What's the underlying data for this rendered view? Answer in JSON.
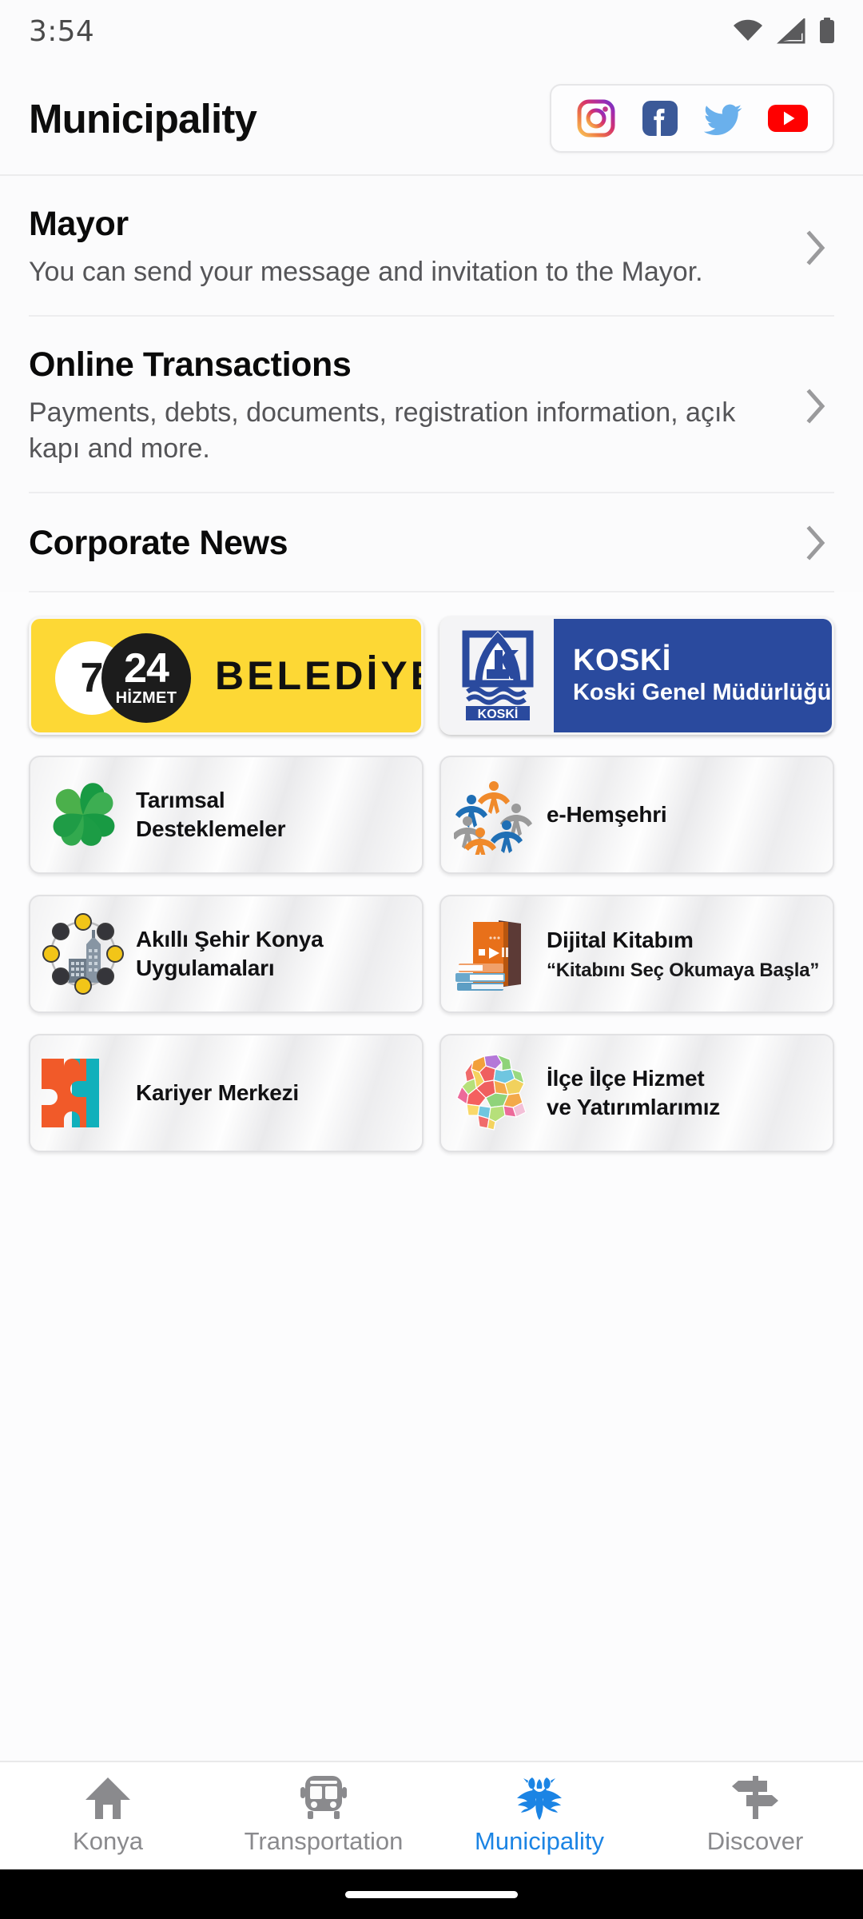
{
  "status_bar": {
    "time": "3:54",
    "icons": [
      "wifi-icon",
      "cellular-signal-icon",
      "battery-icon"
    ]
  },
  "header": {
    "title": "Municipality",
    "social_links": [
      {
        "name": "instagram",
        "label": "Instagram"
      },
      {
        "name": "facebook",
        "label": "Facebook"
      },
      {
        "name": "twitter",
        "label": "Twitter"
      },
      {
        "name": "youtube",
        "label": "YouTube"
      }
    ]
  },
  "menu": [
    {
      "title": "Mayor",
      "subtitle": "You can send your message and invitation to the Mayor."
    },
    {
      "title": "Online Transactions",
      "subtitle": "Payments, debts, documents, registration information, açık kapı and more."
    },
    {
      "title": "Corporate News",
      "subtitle": ""
    }
  ],
  "tiles": [
    {
      "id": "belediye-724",
      "seven": "7",
      "twentyfour": "24",
      "hizmet": "HİZMET",
      "word": "BELEDİYE",
      "background": "#fdd835"
    },
    {
      "id": "koski",
      "logo_text": "KOSKİ",
      "title": "KOSKİ",
      "subtitle": "Koski Genel Müdürlüğü",
      "background": "#2a4a9e"
    },
    {
      "id": "tarimsal-desteklemeler",
      "label_line1": "Tarımsal",
      "label_line2": "Desteklemeler",
      "icon": "clover-icon"
    },
    {
      "id": "e-hemsehri",
      "label_line1": "e-Hemşehri",
      "label_line2": "",
      "icon": "people-circle-icon"
    },
    {
      "id": "akilli-sehir-konya",
      "label_line1": "Akıllı Şehir Konya",
      "label_line2": "Uygulamaları",
      "icon": "smart-city-icon"
    },
    {
      "id": "dijital-kitabim",
      "label_line1": "Dijital Kitabım",
      "label_line2": "",
      "sublabel": "“Kitabını Seç Okumaya Başla”",
      "icon": "books-icon"
    },
    {
      "id": "kariyer-merkezi",
      "label_line1": "Kariyer Merkezi",
      "label_line2": "",
      "icon": "puzzle-icon"
    },
    {
      "id": "ilce-ilce-hizmet",
      "label_line1": "İlçe İlçe Hizmet",
      "label_line2": "ve Yatırımlarımız",
      "icon": "district-map-icon"
    }
  ],
  "bottom_nav": {
    "active_color": "#1b84e4",
    "inactive_color": "#8a8a8d",
    "items": [
      {
        "label": "Konya",
        "icon": "home-icon",
        "active": false
      },
      {
        "label": "Transportation",
        "icon": "bus-icon",
        "active": false
      },
      {
        "label": "Municipality",
        "icon": "double-headed-eagle-icon",
        "active": true
      },
      {
        "label": "Discover",
        "icon": "signpost-icon",
        "active": false
      }
    ]
  }
}
